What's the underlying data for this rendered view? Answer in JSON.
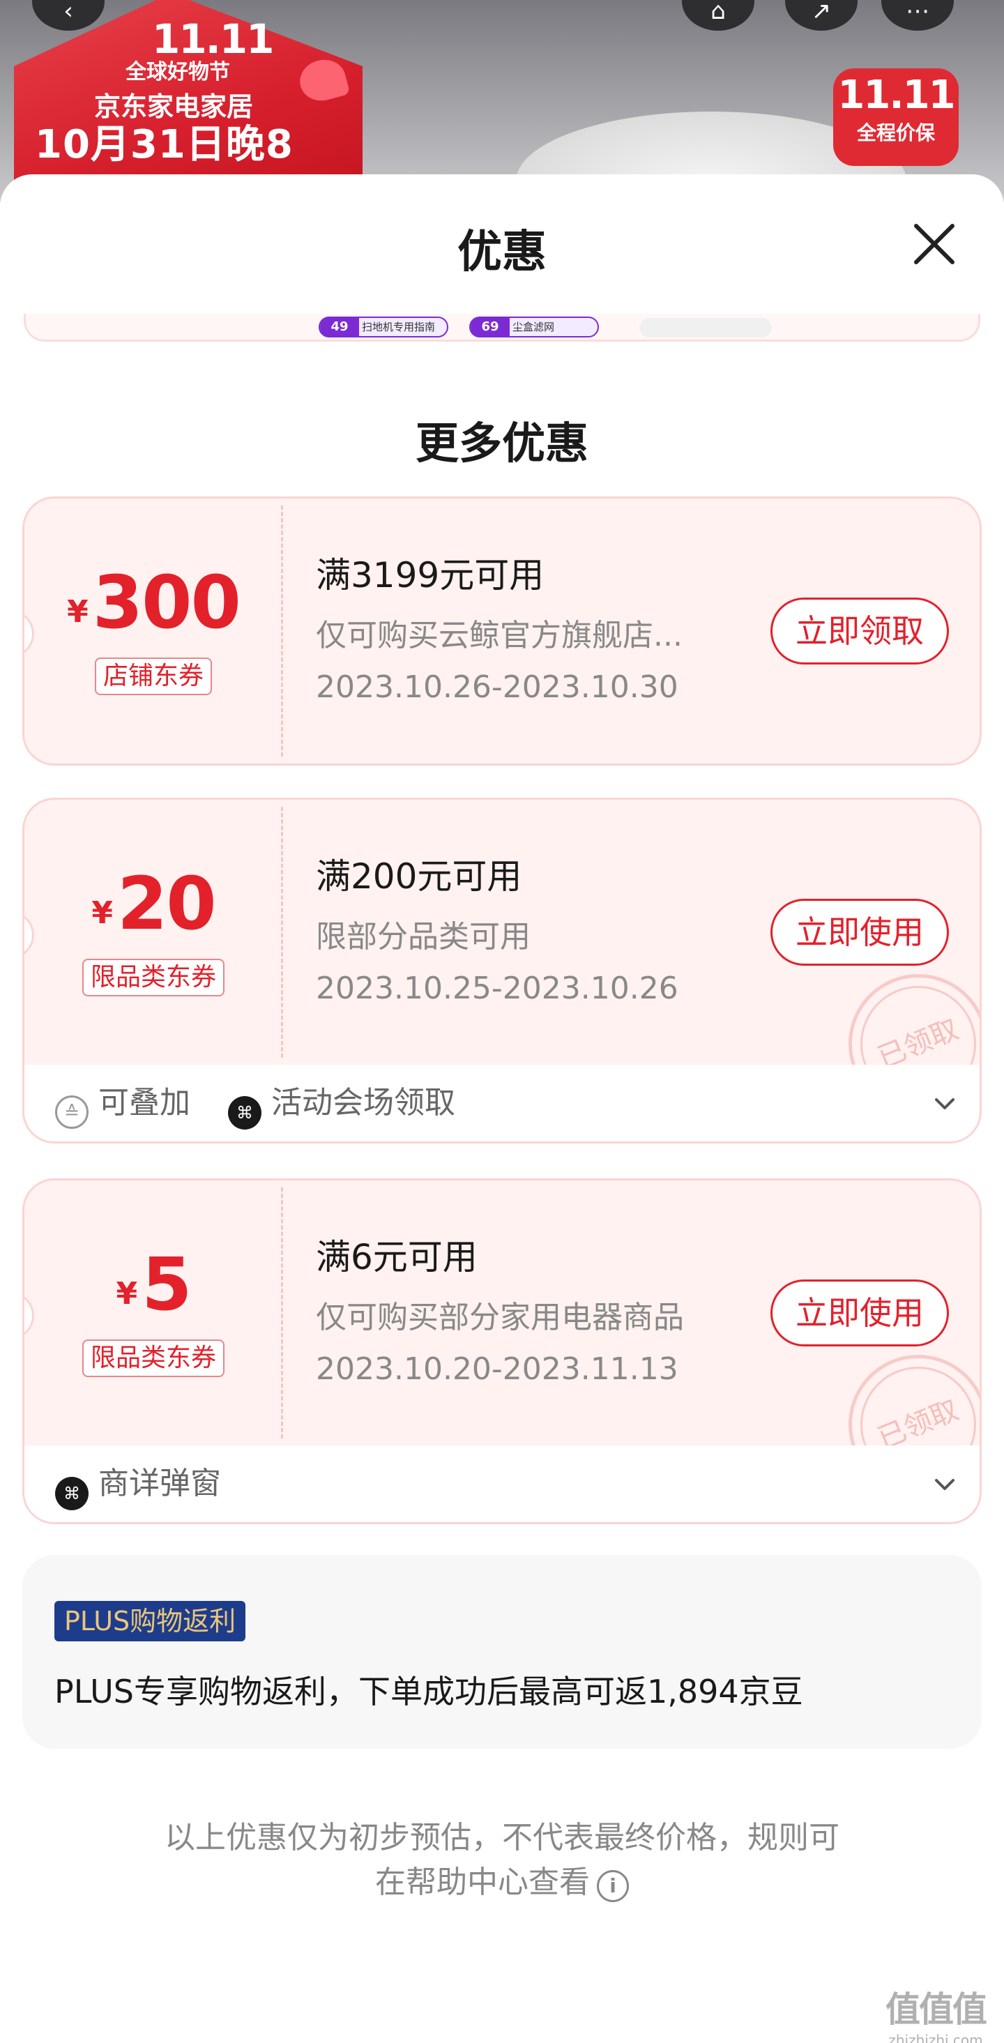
{
  "banner": {
    "logo": "11.11",
    "line1": "全球好物节",
    "line2": "京东家电家居",
    "line3": "10月31日晚8",
    "badge_top": "11.11",
    "badge_bottom": "全程价保",
    "buttons": [
      "back-icon",
      "bookmark-icon",
      "share-icon",
      "more-icon"
    ]
  },
  "sheet": {
    "title": "优惠",
    "close_icon": "close-icon",
    "prev_tags": [
      {
        "price": "49",
        "label": "扫地机专用指南"
      },
      {
        "price": "69",
        "label": "尘盒滤网"
      }
    ]
  },
  "section": {
    "title": "更多优惠"
  },
  "coupons": [
    {
      "currency": "¥",
      "amount": "300",
      "tag": "店铺东券",
      "condition": "满3199元可用",
      "scope": "仅可购买云鲸官方旗舰店...",
      "date": "2023.10.26-2023.10.30",
      "action": "立即领取"
    },
    {
      "currency": "¥",
      "amount": "20",
      "tag": "限品类东券",
      "condition": "满200元可用",
      "scope": "限部分品类可用",
      "date": "2023.10.25-2023.10.26",
      "action": "立即使用",
      "stamp": "已领取",
      "footer": [
        {
          "icon": "stack-icon",
          "label": "可叠加"
        },
        {
          "icon": "ticket-icon",
          "label": "活动会场领取"
        }
      ]
    },
    {
      "currency": "¥",
      "amount": "5",
      "tag": "限品类东券",
      "condition": "满6元可用",
      "scope": "仅可购买部分家用电器商品",
      "date": "2023.10.20-2023.11.13",
      "action": "立即使用",
      "stamp": "已领取",
      "footer": [
        {
          "icon": "ticket-icon",
          "label": "商详弹窗"
        }
      ]
    }
  ],
  "plus": {
    "badge": "PLUS购物返利",
    "text": "PLUS专享购物返利，下单成功后最高可返1,894京豆"
  },
  "disclaimer": {
    "line1": "以上优惠仅为初步预估，不代表最终价格，规则可",
    "line2": "在帮助中心查看"
  },
  "watermark": {
    "logo": "值值值",
    "url": "zhizhizhi.com"
  },
  "colors": {
    "accent": "#e3212b",
    "coupon_bg": "#fff2f0",
    "border": "#fbd4d2",
    "plus_bg": "#1e3c8c"
  }
}
